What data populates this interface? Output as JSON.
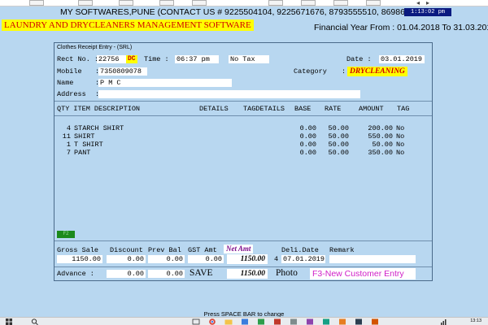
{
  "header": {
    "company_line": "MY SOFTWARES,PUNE (CONTACT US # 9225504104, 9225671676, 8793555510, 8698650487)",
    "clock": "1:13:02 pm",
    "software_name": "LAUNDRY AND DRYCLEANERS MANAGEMENT SOFTWARE",
    "financial_year": "Financial Year From : 01.04.2018 To 31.03.2019"
  },
  "panel": {
    "title": "Clothes Receipt Entry - (SRL)",
    "rect_no_label": "Rect No. :",
    "rect_no": "22756",
    "dc_tag": "DC",
    "time_label": "Time :",
    "time_value": "06:37 pm",
    "tax_mode": "No Tax",
    "date_label": "Date :",
    "date_value": "03.01.2019",
    "mobile_label": "Mobile",
    "mobile_value": "7350809078",
    "category_label": "Category",
    "category_colon": ":",
    "category_value": "DRYCLEANING",
    "name_label": "Name",
    "name_value": "P M C",
    "address_label": "Address",
    "address_value": "",
    "field_colon": ":",
    "green_tag": "F2"
  },
  "table": {
    "headers": {
      "qty_item": "QTY ITEM DESCRIPTION",
      "details": "DETAILS",
      "tagdetails": "TAGDETAILS",
      "base": "BASE",
      "rate": "RATE",
      "amount": "AMOUNT",
      "tag": "TAG"
    },
    "rows": [
      {
        "qty": "4",
        "item": "STARCH SHIRT",
        "base": "0.00",
        "rate": "50.00",
        "amount": "200.00",
        "tag": "No"
      },
      {
        "qty": "11",
        "item": "SHIRT",
        "base": "0.00",
        "rate": "50.00",
        "amount": "550.00",
        "tag": "No"
      },
      {
        "qty": "1",
        "item": "T SHIRT",
        "base": "0.00",
        "rate": "50.00",
        "amount": "50.00",
        "tag": "No"
      },
      {
        "qty": "7",
        "item": "PANT",
        "base": "0.00",
        "rate": "50.00",
        "amount": "350.00",
        "tag": "No"
      }
    ]
  },
  "totals": {
    "gross_sale_label": "Gross Sale",
    "gross_sale": "1150.00",
    "discount_label": "Discount",
    "discount": "0.00",
    "prev_bal_label": "Prev Bal",
    "prev_bal": "0.00",
    "gst_amt_label": "GST Amt",
    "gst_amt": "0.00",
    "net_amt_label": "Net Amt",
    "net_amt": "1150.00",
    "deli_count": "4",
    "deli_date_label": "Deli.Date",
    "deli_date": "07.01.2019",
    "remark_label": "Remark",
    "remark": "",
    "advance_label": "Advance :",
    "advance": "0.00",
    "advance2": "0.00",
    "save_label": "SAVE",
    "save_amount": "1150.00",
    "photo_label": "Photo",
    "new_customer_label": "F3-New Customer Entry"
  },
  "status_bar": {
    "hint": "Press SPACE BAR to change"
  },
  "taskbar": {
    "time": "13:13"
  },
  "colors": {
    "background": "#b8d7f0",
    "highlight_yellow": "#ffff00",
    "accent_red": "#d00000",
    "net_amt_purple": "#7a0a8a",
    "f3_magenta": "#d020c8",
    "clock_bg": "#0a1a80"
  }
}
